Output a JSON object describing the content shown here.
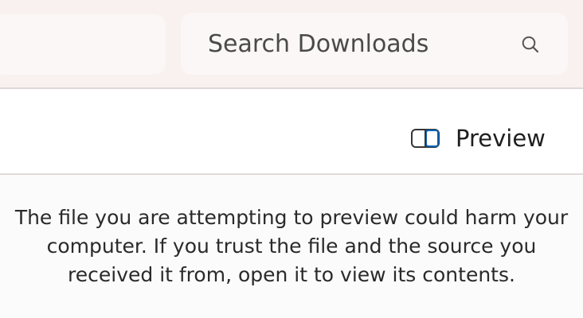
{
  "search": {
    "placeholder": "Search Downloads",
    "icon": "search-icon"
  },
  "toolbar": {
    "preview_label": "Preview",
    "preview_icon": "split-panel-icon"
  },
  "preview_pane": {
    "message": "The file you are attempting to preview could harm your computer. If you trust the file and the source you received it from, open it to view its contents."
  },
  "colors": {
    "header_background": "#f8f1ef",
    "content_background": "#fbfbfb",
    "toggle_icon_accent": "#0b63b6"
  }
}
